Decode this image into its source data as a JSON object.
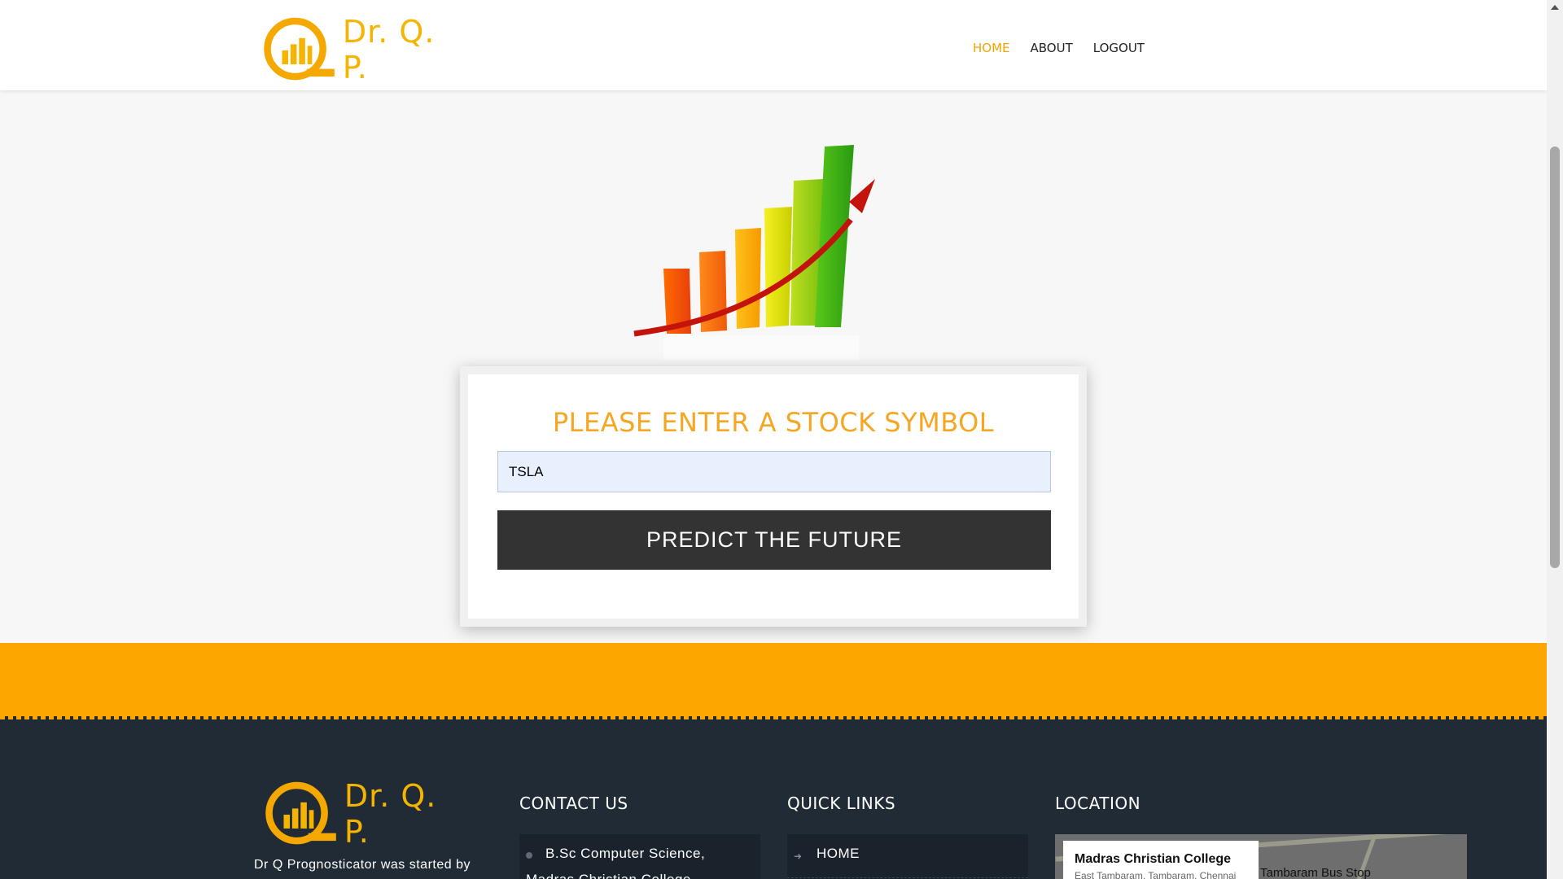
{
  "brand": {
    "name": "Dr. Q. P."
  },
  "nav": {
    "items": [
      {
        "label": "HOME",
        "active": true
      },
      {
        "label": "ABOUT",
        "active": false
      },
      {
        "label": "LOGOUT",
        "active": false
      }
    ]
  },
  "form": {
    "title": "PLEASE ENTER A STOCK SYMBOL",
    "symbol_value": "TSLA",
    "button_label": "PREDICT THE FUTURE"
  },
  "footer": {
    "about_text": "Dr Q Prognosticator was started by",
    "contact": {
      "heading": "CONTACT US",
      "line1": "B.Sc Computer Science,",
      "line2": "Madras Christian College"
    },
    "quick_links": {
      "heading": "QUICK LINKS",
      "items": [
        {
          "label": "HOME"
        }
      ]
    },
    "location": {
      "heading": "LOCATION",
      "map_place": "Madras Christian College",
      "map_address": "East Tambaram, Tambaram, Chennai",
      "map_label": "Tambaram Bus Stop"
    }
  },
  "colors": {
    "accent": "#f5a623",
    "band": "#fda600",
    "footer_bg": "#212b36",
    "button_bg": "#333333"
  },
  "icons": [
    "logo-chart-icon",
    "hero-chart-icon",
    "map-pin-icon",
    "chevron-right-icon"
  ]
}
